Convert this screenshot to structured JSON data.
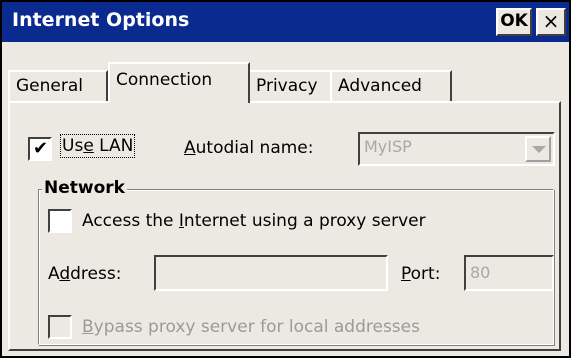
{
  "window": {
    "title": "Internet Options",
    "ok_label": "OK",
    "close_label": "×"
  },
  "tabs": [
    {
      "label": "General"
    },
    {
      "label": "Connection"
    },
    {
      "label": "Privacy"
    },
    {
      "label": "Advanced"
    }
  ],
  "active_tab": "Connection",
  "connection": {
    "use_lan": {
      "label_pre": "Us",
      "label_accel": "e",
      "label_post": " LAN",
      "checked": true
    },
    "autodial": {
      "label_accel": "A",
      "label_post": "utodial name:",
      "value": "MyISP"
    }
  },
  "network": {
    "group_title": "Network",
    "proxy": {
      "label_pre": "Access the ",
      "label_accel": "I",
      "label_post": "nternet using a proxy server",
      "checked": false
    },
    "address": {
      "label_pre": "A",
      "label_accel": "d",
      "label_post": "dress:",
      "value": ""
    },
    "port": {
      "label_accel": "P",
      "label_post": "ort:",
      "value": "80"
    },
    "bypass": {
      "label_accel": "B",
      "label_post": "ypass proxy server for local addresses",
      "checked": false
    }
  }
}
